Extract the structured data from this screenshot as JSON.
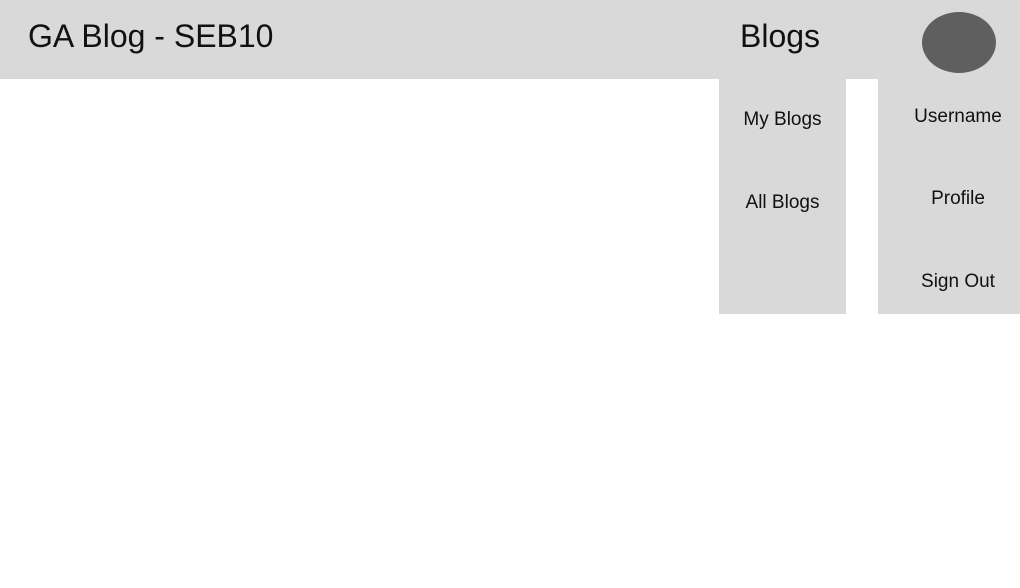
{
  "header": {
    "site_title": "GA Blog - SEB10",
    "blogs_label": "Blogs"
  },
  "blogs_menu": {
    "items": [
      {
        "label": "My Blogs"
      },
      {
        "label": "All Blogs"
      }
    ]
  },
  "user_menu": {
    "items": [
      {
        "label": "Username"
      },
      {
        "label": "Profile"
      },
      {
        "label": "Sign Out"
      }
    ]
  },
  "colors": {
    "header_bg": "#d9d9d9",
    "menu_bg": "#d9d9d9",
    "avatar": "#5f5f5f",
    "page_bg": "#ffffff"
  },
  "icons": {
    "avatar": "user-avatar-icon"
  }
}
